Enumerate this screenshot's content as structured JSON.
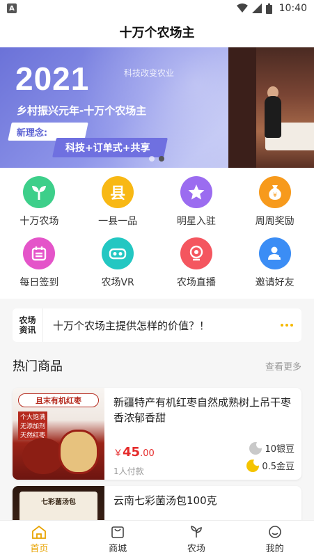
{
  "status_bar": {
    "badge": "A",
    "time": "10:40"
  },
  "header": {
    "title": "十万个农场主"
  },
  "banner": {
    "year": "2021",
    "subtitle": "乡村振兴元年-十万个农场主",
    "concept": "新理念:",
    "tags": "科技+订单式+共享",
    "background_text": "科技改变农业"
  },
  "features": [
    {
      "label": "十万农场",
      "icon": "sprout-icon",
      "color": "#3dcf8a"
    },
    {
      "label": "一县一品",
      "icon": "county-icon",
      "color": "#f8b814"
    },
    {
      "label": "明星入驻",
      "icon": "star-icon",
      "color": "#9b6cf0"
    },
    {
      "label": "周周奖励",
      "icon": "money-bag-icon",
      "color": "#f79a1c"
    },
    {
      "label": "每日签到",
      "icon": "calendar-icon",
      "color": "#e454c9"
    },
    {
      "label": "农场VR",
      "icon": "vr-headset-icon",
      "color": "#23c7c2"
    },
    {
      "label": "农场直播",
      "icon": "camera-icon",
      "color": "#f4565f"
    },
    {
      "label": "邀请好友",
      "icon": "add-friend-icon",
      "color": "#3b8df5"
    }
  ],
  "notice": {
    "logo_top": "农场",
    "logo_bottom": "资讯",
    "text": "十万个农场主提供怎样的价值？！"
  },
  "hot_products": {
    "title": "热门商品",
    "more": "查看更多",
    "items": [
      {
        "image_tag": "且末有机红枣",
        "image_bullets": [
          "个大饱满",
          "无添加剂",
          "天然红枣"
        ],
        "name": "新疆特产有机红枣自然成熟树上吊干枣香浓郁香甜",
        "price_symbol": "￥",
        "price_int": "45",
        "price_dec": ".00",
        "buyers": "1人付款",
        "silver": "10银豆",
        "gold": "0.5金豆"
      },
      {
        "image_tag": "七彩菌汤包",
        "name": "云南七彩菌汤包100克"
      }
    ]
  },
  "tabbar": {
    "items": [
      {
        "label": "首页",
        "icon": "home-icon",
        "active": true
      },
      {
        "label": "商城",
        "icon": "shop-bag-icon",
        "active": false
      },
      {
        "label": "农场",
        "icon": "farm-leaf-icon",
        "active": false
      },
      {
        "label": "我的",
        "icon": "profile-icon",
        "active": false
      }
    ]
  },
  "colors": {
    "accent": "#e8a300",
    "price": "#e52b2b"
  }
}
